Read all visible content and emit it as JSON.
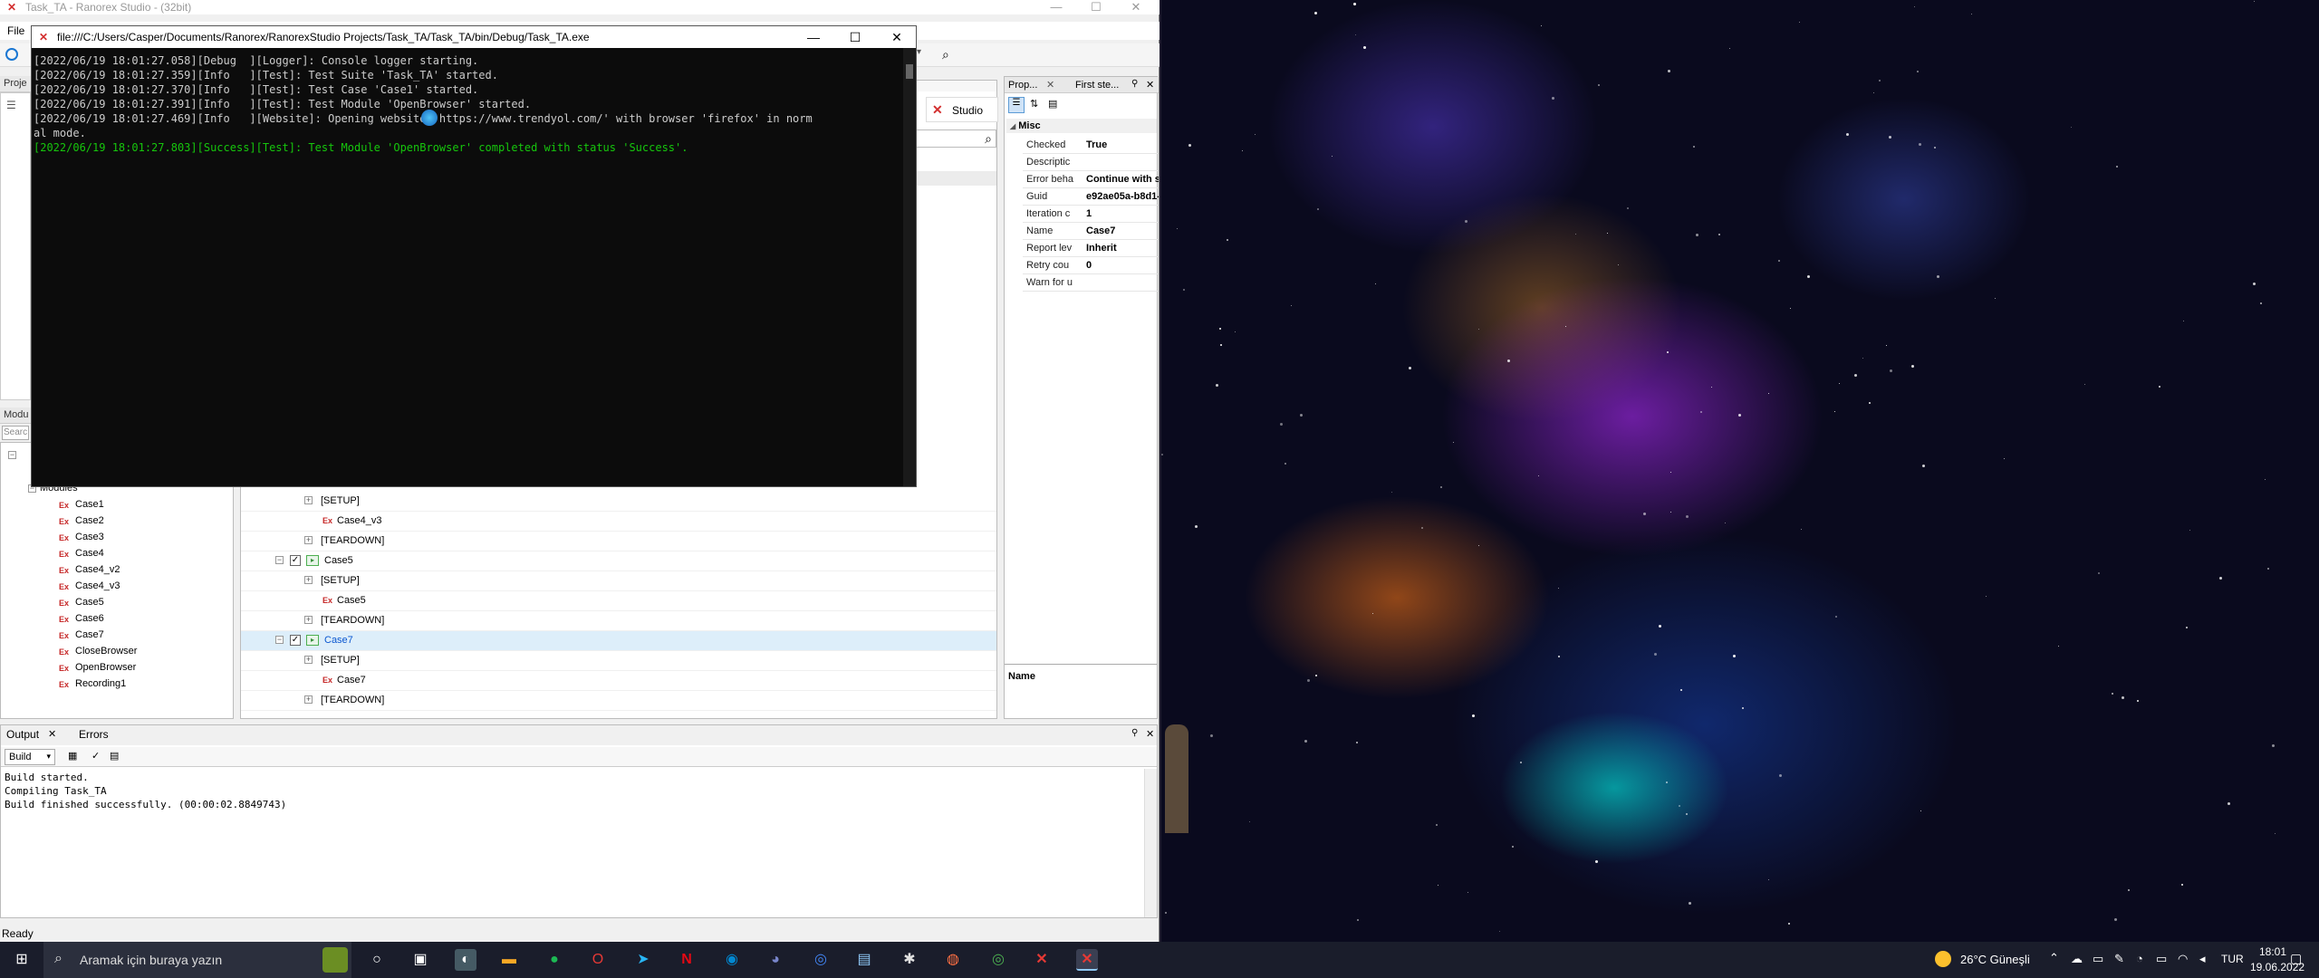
{
  "ranorex": {
    "title": "Task_TA - Ranorex Studio - (32bit)",
    "menu_file": "File",
    "panel_project": "Proje",
    "panel_modules": "Modu",
    "search_ph": "Searc",
    "studio_label": "Studio",
    "status": "Ready"
  },
  "tree": {
    "root": "Modules",
    "items": [
      "Case1",
      "Case2",
      "Case3",
      "Case4",
      "Case4_v2",
      "Case4_v3",
      "Case5",
      "Case6",
      "Case7",
      "CloseBrowser",
      "OpenBrowser",
      "Recording1"
    ]
  },
  "suite": {
    "rows": [
      {
        "label": "[SETUP]"
      },
      {
        "label": "Case4_v3"
      },
      {
        "label": "[TEARDOWN]"
      },
      {
        "label": "Case5"
      },
      {
        "label": "[SETUP]"
      },
      {
        "label": "Case5"
      },
      {
        "label": "[TEARDOWN]"
      },
      {
        "label": "Case7"
      },
      {
        "label": "[SETUP]"
      },
      {
        "label": "Case7"
      },
      {
        "label": "[TEARDOWN]"
      }
    ]
  },
  "props": {
    "tab1": "Prop...",
    "tab2": "First ste...",
    "section": "Misc",
    "rows": [
      {
        "k": "Checked",
        "v": "True"
      },
      {
        "k": "Descriptic",
        "v": ""
      },
      {
        "k": "Error beha",
        "v": "Continue with s"
      },
      {
        "k": "Guid",
        "v": "e92ae05a-b8d1-"
      },
      {
        "k": "Iteration c",
        "v": "1"
      },
      {
        "k": "Name",
        "v": "Case7"
      },
      {
        "k": "Report lev",
        "v": "Inherit"
      },
      {
        "k": "Retry cou",
        "v": "0"
      },
      {
        "k": "Warn for u",
        "v": ""
      }
    ],
    "desc_title": "Name"
  },
  "output": {
    "tab_output": "Output",
    "tab_errors": "Errors",
    "build_select": "Build",
    "lines": [
      "Build started.",
      "Compiling Task_TA",
      "Build finished successfully. (00:00:02.8849743)"
    ]
  },
  "console": {
    "title": "file:///C:/Users/Casper/Documents/Ranorex/RanorexStudio Projects/Task_TA/Task_TA/bin/Debug/Task_TA.exe",
    "lines": [
      "[2022/06/19 18:01:27.058][Debug  ][Logger]: Console logger starting.",
      "[2022/06/19 18:01:27.359][Info   ][Test]: Test Suite 'Task_TA' started.",
      "[2022/06/19 18:01:27.370][Info   ][Test]: Test Case 'Case1' started.",
      "[2022/06/19 18:01:27.391][Info   ][Test]: Test Module 'OpenBrowser' started.",
      "[2022/06/19 18:01:27.469][Info   ][Website]: Opening website 'https://www.trendyol.com/' with browser 'firefox' in norm",
      "al mode.",
      "[2022/06/19 18:01:27.803][Success][Test]: Test Module 'OpenBrowser' completed with status 'Success'."
    ]
  },
  "taskbar": {
    "search_placeholder": "Aramak için buraya yazın",
    "weather": "26°C  Güneşli",
    "lang": "TUR",
    "time": "18:01",
    "date": "19.06.2022"
  },
  "colors": {
    "success_text": "#16c60c",
    "console_bg": "#0c0c0c",
    "selection": "#ddeefa"
  }
}
